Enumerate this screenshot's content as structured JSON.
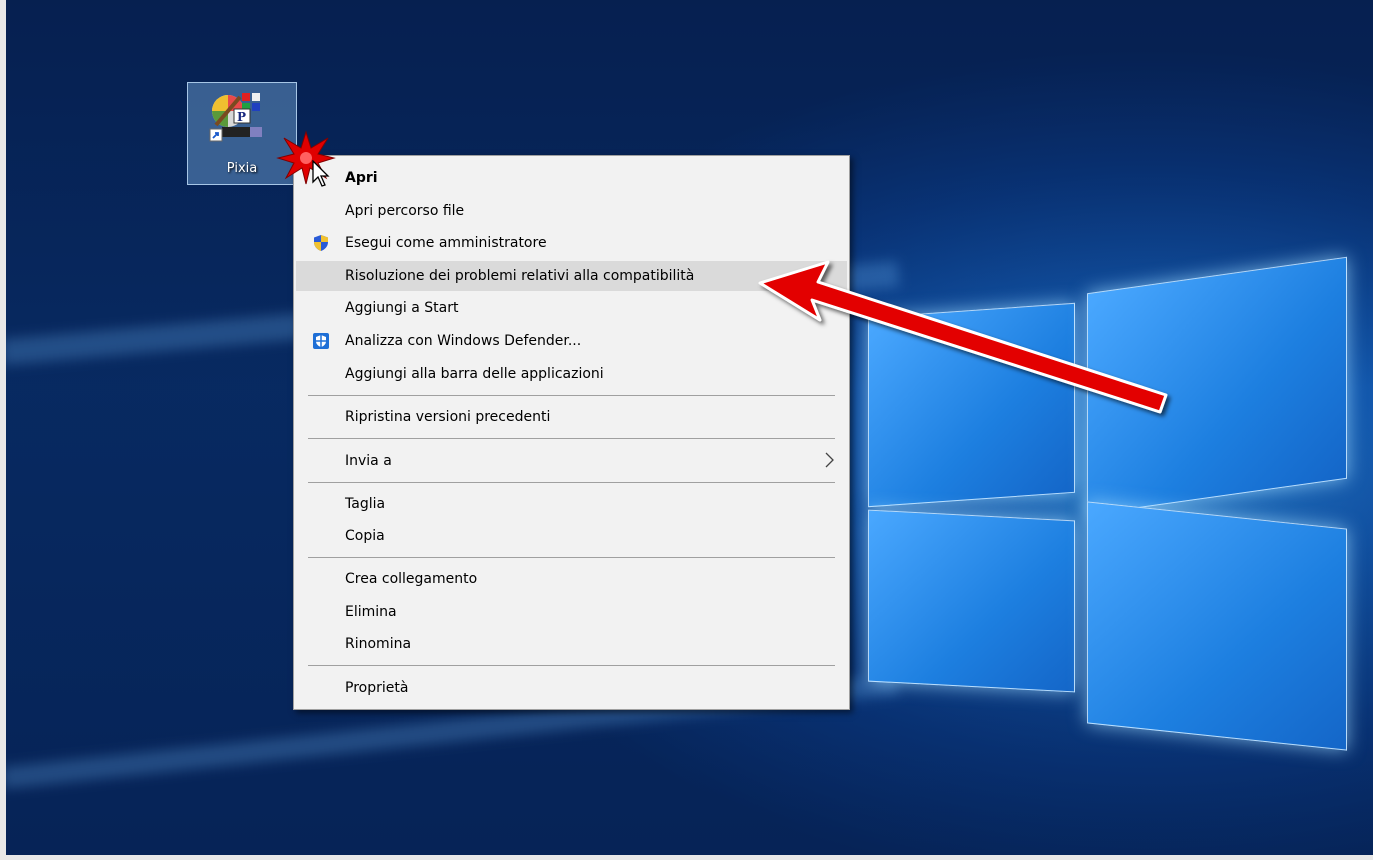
{
  "desktop": {
    "icon": {
      "label": "Pixia",
      "icon_name": "pixia-app-icon"
    }
  },
  "context_menu": {
    "items": [
      {
        "label": "Apri",
        "bold": true,
        "icon": null
      },
      {
        "label": "Apri percorso file",
        "icon": null
      },
      {
        "label": "Esegui come amministratore",
        "icon": "uac-shield-icon"
      },
      {
        "label": "Risoluzione dei problemi relativi alla compatibilità",
        "icon": null,
        "highlighted": true
      },
      {
        "label": "Aggiungi a Start",
        "icon": null
      },
      {
        "label": "Analizza con Windows Defender...",
        "icon": "windows-defender-icon"
      },
      {
        "label": "Aggiungi alla barra delle applicazioni",
        "icon": null
      },
      {
        "label": "Ripristina versioni precedenti",
        "icon": null
      },
      {
        "label": "Invia a",
        "icon": null,
        "submenu": true
      },
      {
        "label": "Taglia",
        "icon": null
      },
      {
        "label": "Copia",
        "icon": null
      },
      {
        "label": "Crea collegamento",
        "icon": null
      },
      {
        "label": "Elimina",
        "icon": null
      },
      {
        "label": "Rinomina",
        "icon": null
      },
      {
        "label": "Proprietà",
        "icon": null
      }
    ]
  },
  "colors": {
    "menu_background": "#f2f2f2",
    "menu_highlight": "#dadada",
    "annotation_arrow": "#e00000",
    "desktop_accent": "#1a73d8"
  }
}
